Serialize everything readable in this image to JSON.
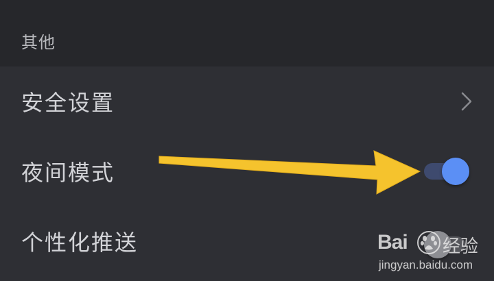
{
  "section": {
    "title": "其他"
  },
  "settings": {
    "items": [
      {
        "label": "安全设置",
        "control": "chevron"
      },
      {
        "label": "夜间模式",
        "control": "toggle",
        "state": "on"
      },
      {
        "label": "个性化推送",
        "control": "toggle",
        "state": "off"
      }
    ]
  },
  "colors": {
    "toggle_on_knob": "#5b8ff5",
    "annotation_arrow": "#f5c32d",
    "background": "#2e2f34",
    "header_background": "#26272b"
  },
  "watermark": {
    "brand": "Bai",
    "brand_cn": "经验",
    "url": "jingyan.baidu.com"
  }
}
